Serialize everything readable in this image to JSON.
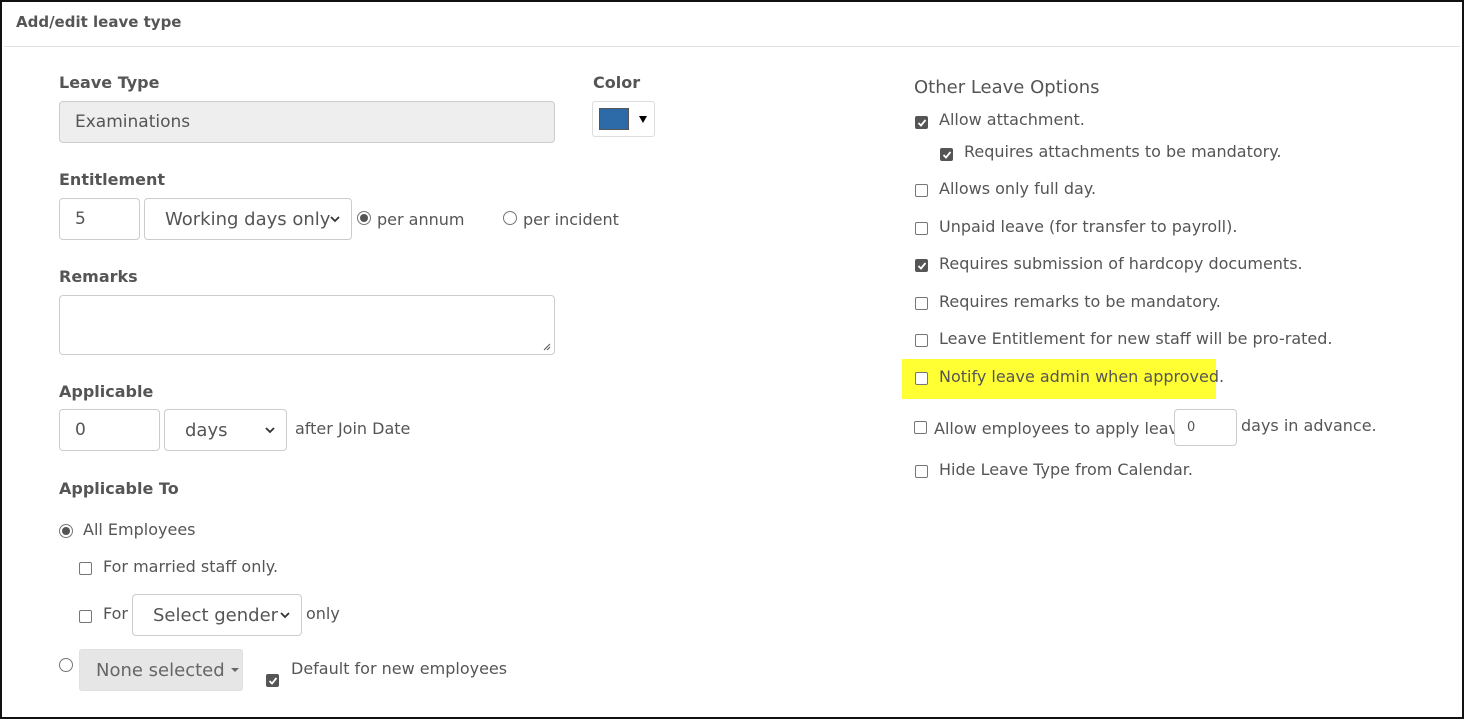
{
  "header": {
    "title": "Add/edit leave type"
  },
  "leave_type": {
    "label": "Leave Type",
    "value": "Examinations"
  },
  "color": {
    "label": "Color",
    "swatch": "#2c6aa8"
  },
  "entitlement": {
    "label": "Entitlement",
    "amount": "5",
    "unit": "Working days only",
    "per_annum": "per annum",
    "per_incident": "per incident"
  },
  "remarks": {
    "label": "Remarks",
    "value": ""
  },
  "applicable": {
    "label": "Applicable",
    "amount": "0",
    "unit": "days",
    "suffix": "after Join Date"
  },
  "applicable_to": {
    "label": "Applicable To",
    "all_employees": "All Employees",
    "married_only": "For married staff only.",
    "for_label": "For",
    "gender_select": "Select gender",
    "only_label": "only",
    "none_selected": "None selected",
    "default_new": "Default for new employees"
  },
  "other_options": {
    "heading": "Other Leave Options",
    "allow_attachment": "Allow attachment.",
    "attachments_mandatory": "Requires attachments to be mandatory.",
    "full_day_only": "Allows only full day.",
    "unpaid_leave": "Unpaid leave (for transfer to payroll).",
    "hardcopy_docs": "Requires submission of hardcopy documents.",
    "remarks_mandatory": "Requires remarks to be mandatory.",
    "pro_rated": "Leave Entitlement for new staff will be pro-rated.",
    "notify_admin": "Notify leave admin when approved.",
    "advance_prefix": "Allow employees to apply leave",
    "advance_days": "0",
    "advance_suffix": "days in advance.",
    "hide_calendar": "Hide Leave Type from Calendar."
  },
  "colors": {
    "highlight": "#ffff33",
    "swatch": "#2c6aa8"
  }
}
